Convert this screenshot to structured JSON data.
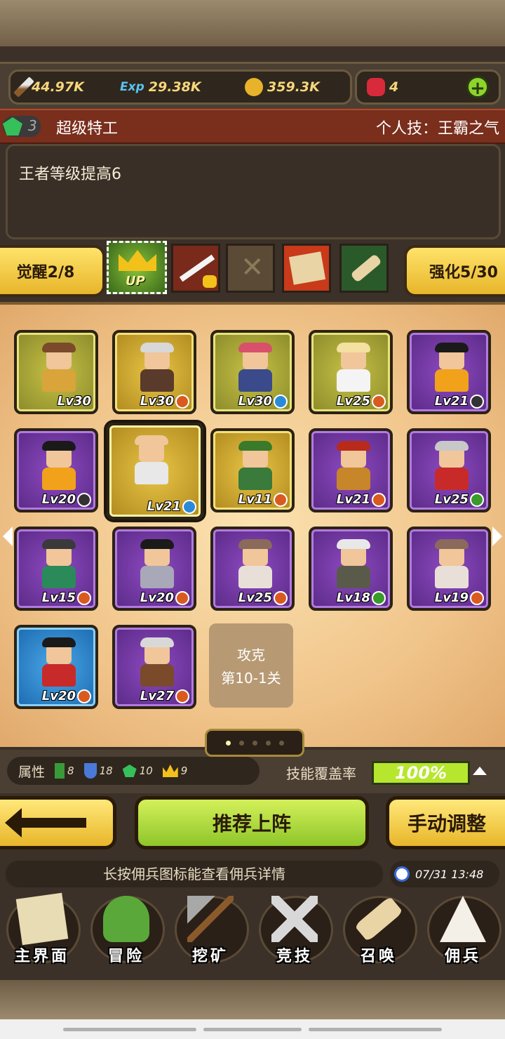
{
  "resources": {
    "attack": "44.97K",
    "exp_icon_label": "Exp",
    "exp": "29.38K",
    "gold": "359.3K",
    "rubies": "4"
  },
  "hero": {
    "gem_level": "3",
    "title": "超级特工",
    "skill": "个人技：王霸之气",
    "description": "王者等级提高6"
  },
  "skill_row": {
    "awaken_label": "觉醒2/8",
    "enhance_label": "强化5/30",
    "up_slot_label": "UP"
  },
  "cards": [
    {
      "lv": "Lv30",
      "badge": "",
      "frame": "olive",
      "hair": "#7a4a2a",
      "body": "#d9a43a"
    },
    {
      "lv": "Lv30",
      "badge": "orange",
      "frame": "gold",
      "hair": "#d8d8d8",
      "body": "#5a3a2a"
    },
    {
      "lv": "Lv30",
      "badge": "blue",
      "frame": "olive",
      "hair": "#d8506a",
      "body": "#3a4a8a"
    },
    {
      "lv": "Lv25",
      "badge": "orange",
      "frame": "olive",
      "hair": "#f4e0a0",
      "body": "#f4f4f4"
    },
    {
      "lv": "Lv21",
      "badge": "dark",
      "frame": "purple",
      "hair": "#1a1a1a",
      "body": "#f2a21a"
    },
    {
      "lv": "Lv20",
      "badge": "dark",
      "frame": "purple",
      "hair": "#1a1a1a",
      "body": "#f2a21a"
    },
    {
      "lv": "Lv21",
      "badge": "blue",
      "frame": "gold sel",
      "hair": "#f0c69a",
      "body": "#e8e8e8"
    },
    {
      "lv": "Lv11",
      "badge": "orange",
      "frame": "gold",
      "hair": "#3a7a2a",
      "body": "#3a7a3a"
    },
    {
      "lv": "Lv21",
      "badge": "orange",
      "frame": "purple",
      "hair": "#b82a1a",
      "body": "#c8862a"
    },
    {
      "lv": "Lv25",
      "badge": "green",
      "frame": "purple",
      "hair": "#c8c8c8",
      "body": "#c82a2a"
    },
    {
      "lv": "Lv15",
      "badge": "orange",
      "frame": "purple",
      "hair": "#3a3a3a",
      "body": "#2a8a5a"
    },
    {
      "lv": "Lv20",
      "badge": "orange",
      "frame": "purple",
      "hair": "#1a1a1a",
      "body": "#a8a8b8"
    },
    {
      "lv": "Lv25",
      "badge": "orange",
      "frame": "purple",
      "hair": "#8a6a5a",
      "body": "#e8e0d8"
    },
    {
      "lv": "Lv18",
      "badge": "green",
      "frame": "purple",
      "hair": "#e8e8e8",
      "body": "#5a5a4a"
    },
    {
      "lv": "Lv19",
      "badge": "orange",
      "frame": "purple",
      "hair": "#8a6a5a",
      "body": "#e8e0d8"
    },
    {
      "lv": "Lv20",
      "badge": "orange",
      "frame": "blue",
      "hair": "#1a1a1a",
      "body": "#c82a2a"
    },
    {
      "lv": "Lv27",
      "badge": "orange",
      "frame": "purple",
      "hair": "#d8d8d8",
      "body": "#7a4a2a"
    }
  ],
  "locked_card": {
    "line1": "攻克",
    "line2": "第10-1关"
  },
  "pager": {
    "pages": 5,
    "current": 1
  },
  "attributes": {
    "label": "属性",
    "items": [
      {
        "icon": "sword-plant-icon",
        "value": "8"
      },
      {
        "icon": "shield-icon",
        "value": "18"
      },
      {
        "icon": "gem-icon",
        "value": "10"
      },
      {
        "icon": "crown-icon",
        "value": "9"
      }
    ],
    "coverage_label": "技能覆盖率",
    "coverage_value": "100%"
  },
  "actions": {
    "recommend": "推荐上阵",
    "manual": "手动调整"
  },
  "hint": "长按佣兵图标能查看佣兵详情",
  "datetime": "07/31 13:48",
  "nav": [
    {
      "label": "主界面",
      "icon": "map-scroll-icon",
      "color": "#e8dcb4"
    },
    {
      "label": "冒险",
      "icon": "island-icon",
      "color": "#5aa83a"
    },
    {
      "label": "挖矿",
      "icon": "pickaxe-icon",
      "color": "#a8a8a8"
    },
    {
      "label": "竞技",
      "icon": "crossed-swords-icon",
      "color": "#d8d8d8"
    },
    {
      "label": "召唤",
      "icon": "scroll-icon",
      "color": "#e8d4a4"
    },
    {
      "label": "佣兵",
      "icon": "tent-icon",
      "color": "#f4f0e8"
    }
  ]
}
